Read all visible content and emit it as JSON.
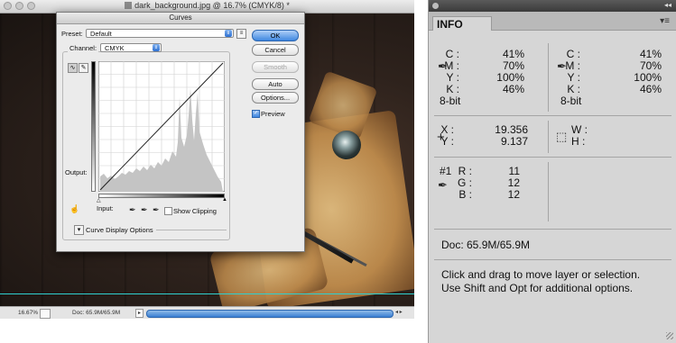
{
  "document": {
    "window_title": "dark_background.jpg @ 16.7% (CMYK/8) *",
    "zoom": "16.67%",
    "doc_size": "Doc: 65.9M/65.9M"
  },
  "curves": {
    "title": "Curves",
    "preset_label": "Preset:",
    "preset_value": "Default",
    "channel_label": "Channel:",
    "channel_value": "CMYK",
    "buttons": {
      "ok": "OK",
      "cancel": "Cancel",
      "smooth": "Smooth",
      "auto": "Auto",
      "options": "Options..."
    },
    "preview_label": "Preview",
    "preview_checked": true,
    "output_label": "Output:",
    "input_label": "Input:",
    "show_clipping_label": "Show Clipping",
    "show_clipping_checked": false,
    "curve_display_options_label": "Curve Display Options"
  },
  "info": {
    "tab_label": "INFO",
    "color_left": {
      "channels": [
        {
          "label": "C :",
          "value": "41%"
        },
        {
          "label": "M :",
          "value": "70%"
        },
        {
          "label": "Y :",
          "value": "100%"
        },
        {
          "label": "K :",
          "value": "46%"
        }
      ],
      "bitdepth": "8-bit"
    },
    "color_right": {
      "channels": [
        {
          "label": "C :",
          "value": "41%"
        },
        {
          "label": "M :",
          "value": "70%"
        },
        {
          "label": "Y :",
          "value": "100%"
        },
        {
          "label": "K :",
          "value": "46%"
        }
      ],
      "bitdepth": "8-bit"
    },
    "position": {
      "x_label": "X :",
      "x_value": "19.356",
      "y_label": "Y :",
      "y_value": "9.137"
    },
    "size": {
      "w_label": "W :",
      "h_label": "H :"
    },
    "sampler": {
      "number": "#1",
      "channels": [
        {
          "label": "R :",
          "value": "11"
        },
        {
          "label": "G :",
          "value": "12"
        },
        {
          "label": "B :",
          "value": "12"
        }
      ]
    },
    "doc_size": "Doc: 65.9M/65.9M",
    "hint_line1": "Click and drag to move layer or selection.",
    "hint_line2": "Use Shift and Opt for additional options."
  }
}
